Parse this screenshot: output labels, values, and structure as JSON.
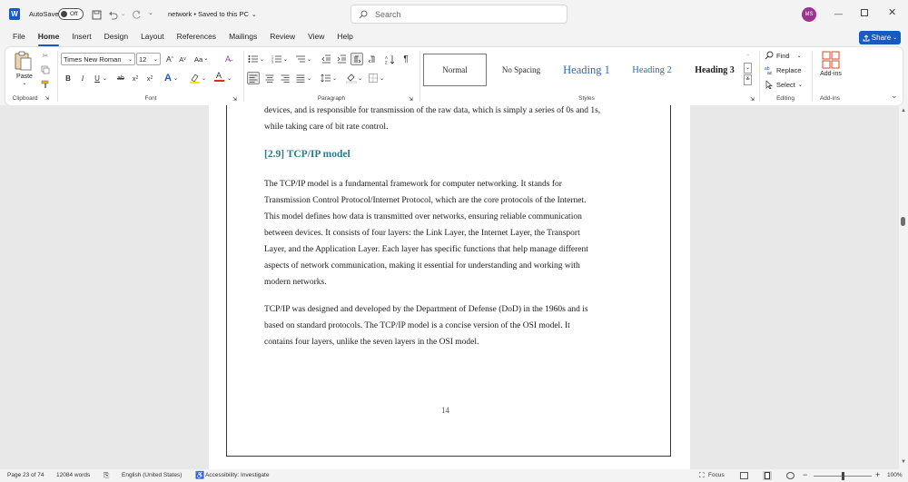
{
  "titlebar": {
    "autosave_label": "AutoSave",
    "autosave_state": "Off",
    "doc_title": "network • Saved to this PC",
    "search_placeholder": "Search",
    "user_initials": "MS"
  },
  "menu": {
    "tabs": [
      "File",
      "Home",
      "Insert",
      "Design",
      "Layout",
      "References",
      "Mailings",
      "Review",
      "View",
      "Help"
    ],
    "active_tab": "Home",
    "share_label": "Share"
  },
  "ribbon": {
    "clipboard": {
      "paste_label": "Paste",
      "group_label": "Clipboard"
    },
    "font": {
      "font_name": "Times New Roman",
      "font_size": "12",
      "group_label": "Font",
      "case_label": "Aa"
    },
    "paragraph": {
      "group_label": "Paragraph"
    },
    "styles": {
      "group_label": "Styles",
      "items": [
        "Normal",
        "No Spacing",
        "Heading 1",
        "Heading 2",
        "Heading 3"
      ]
    },
    "editing": {
      "find_label": "Find",
      "replace_label": "Replace",
      "select_label": "Select",
      "group_label": "Editing"
    },
    "addins": {
      "label": "Add-ins",
      "group_label": "Add-ins"
    }
  },
  "document": {
    "top_lines": [
      "devices, and is responsible for transmission of the raw data, which is simply a series of 0s and 1s,",
      "while taking care of bit rate control."
    ],
    "heading": "[2.9] TCP/IP model",
    "para1_lines": [
      "The TCP/IP model is a fundamental framework for computer networking. It stands for",
      "Transmission Control Protocol/Internet Protocol, which are the core protocols of the Internet.",
      "This model defines how data is transmitted over networks, ensuring reliable communication",
      "between devices. It consists of four layers: the Link Layer, the Internet Layer, the Transport",
      "Layer, and the Application Layer. Each layer has specific functions that help manage different",
      "aspects of network communication, making it essential for understanding and working with",
      "modern networks."
    ],
    "para2_lines": [
      "TCP/IP was designed and developed by the Department of Defense (DoD) in the 1960s and is",
      "based on standard protocols. The TCP/IP model is a concise version of the OSI model. It",
      "contains four layers, unlike the seven layers in the OSI model."
    ],
    "page_number": "14"
  },
  "status": {
    "page": "Page 23 of 74",
    "words": "12084 words",
    "language": "English (United States)",
    "accessibility": "Accessibility: Investigate",
    "focus": "Focus",
    "zoom": "100%",
    "zoom_fraction": 0.5
  },
  "colors": {
    "accent": "#185abd",
    "heading": "#2e7a8a",
    "avatar": "#9c3391"
  }
}
